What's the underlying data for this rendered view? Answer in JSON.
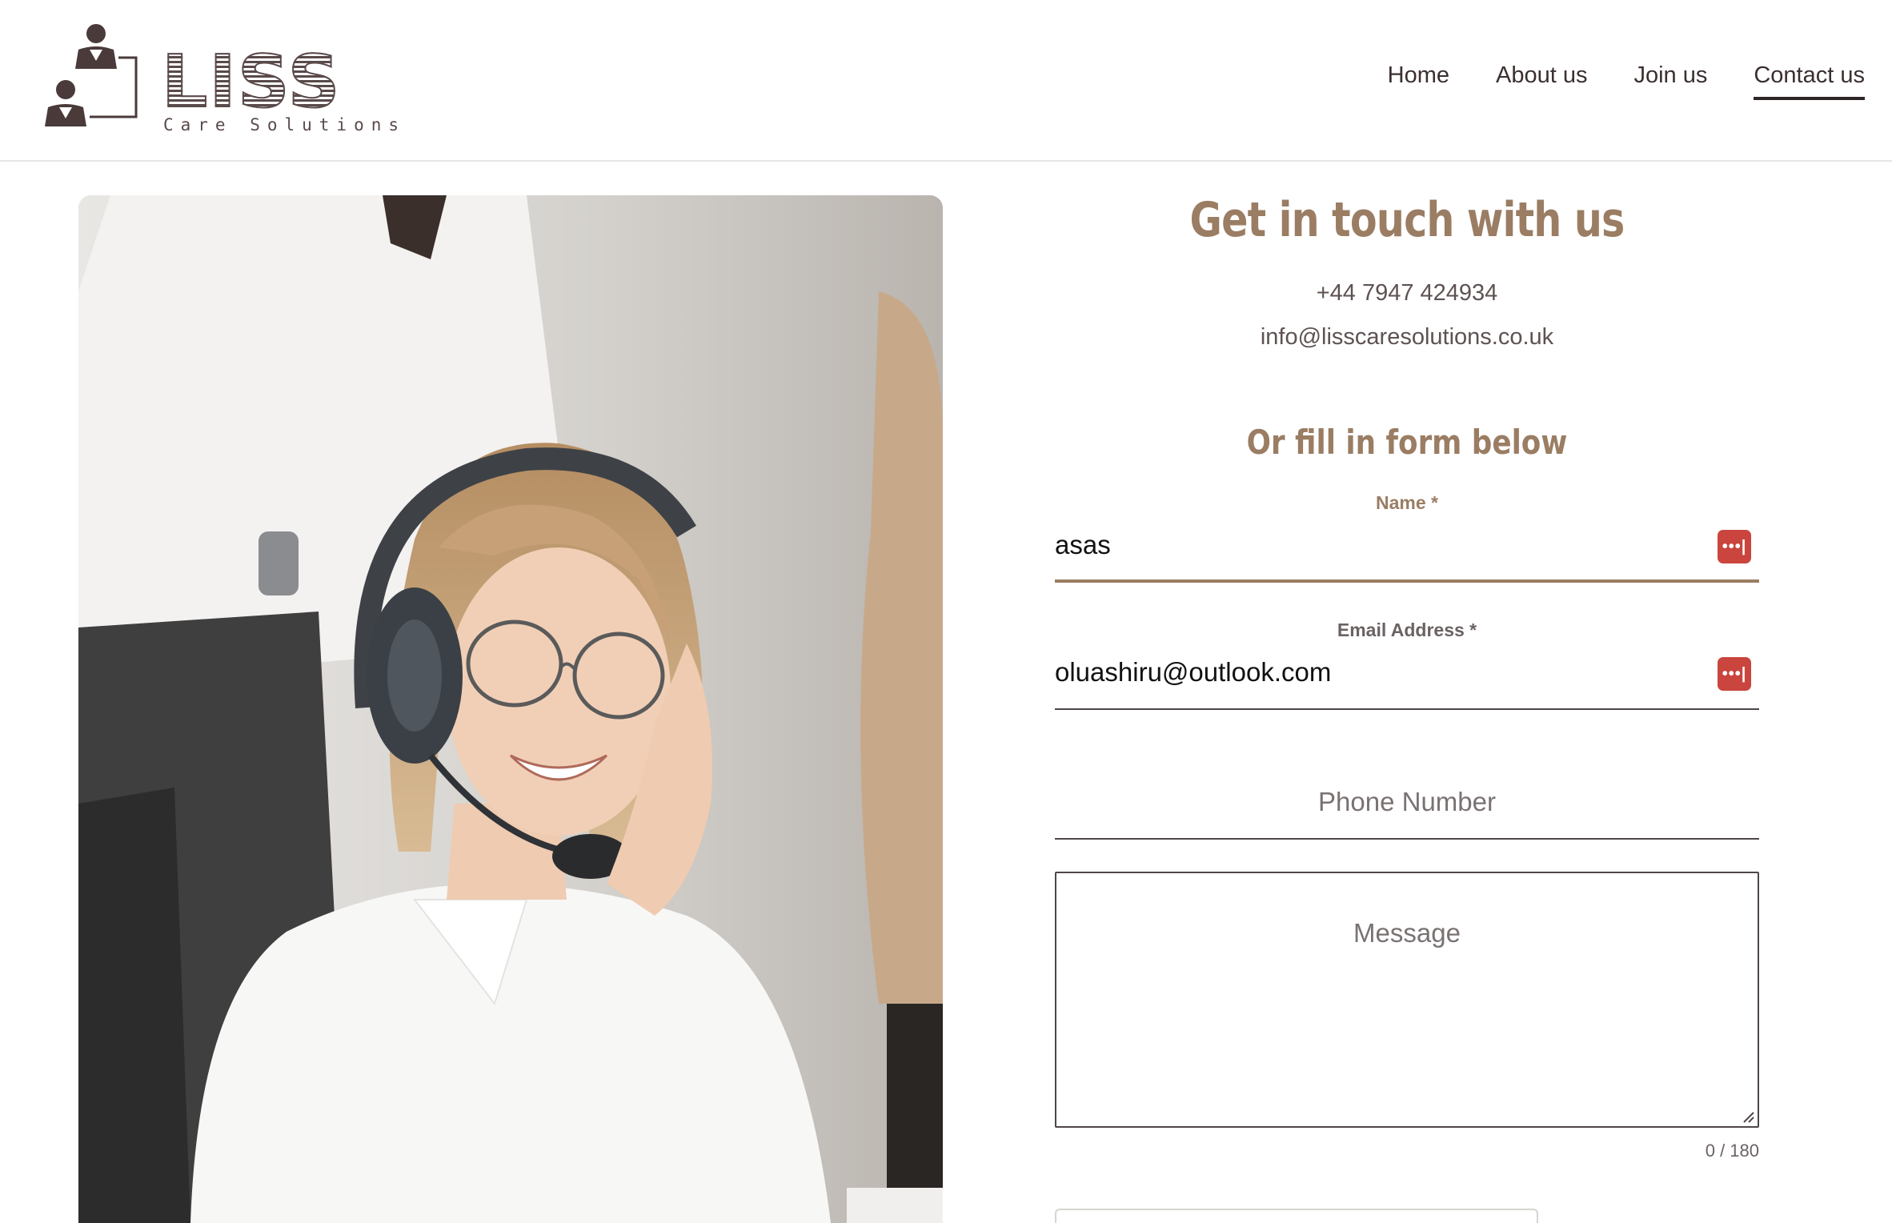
{
  "header": {
    "logo_word": "LISS",
    "logo_subtitle": "Care Solutions",
    "nav": [
      {
        "label": "Home",
        "active": false
      },
      {
        "label": "About us",
        "active": false
      },
      {
        "label": "Join us",
        "active": false
      },
      {
        "label": "Contact us",
        "active": true
      }
    ]
  },
  "contact": {
    "heading": "Get in touch with us",
    "phone": "+44 7947 424934",
    "email": "info@lisscaresolutions.co.uk",
    "form_heading": "Or fill in form below",
    "name_label": "Name *",
    "name_value": "asas",
    "email_label": "Email Address *",
    "email_value": "oluashiru@outlook.com",
    "phone_placeholder": "Phone Number",
    "message_placeholder": "Message",
    "message_counter": "0 / 180"
  },
  "icons": {
    "password_manager": "password-manager-icon",
    "logo_people": "people-icon"
  },
  "colors": {
    "accent": "#9a7d63",
    "text_dark": "#3b2f2f",
    "password_icon": "#c9453d"
  }
}
